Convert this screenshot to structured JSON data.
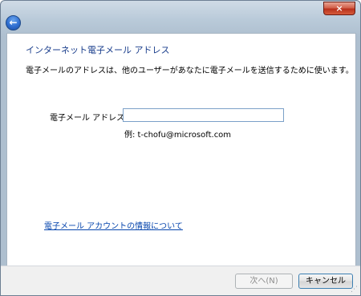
{
  "titlebar": {
    "close_label": "×",
    "close_icon": "close-icon"
  },
  "nav": {
    "back_label": "←",
    "back_icon": "back-arrow-icon"
  },
  "page": {
    "heading": "インターネット電子メール アドレス",
    "description": "電子メールのアドレスは、他のユーザーがあなたに電子メールを送信するために使います。",
    "email_label": "電子メール アドレス(E):",
    "email_value": "",
    "example": "例: t-chofu@microsoft.com",
    "info_link": "電子メール アカウントの情報について"
  },
  "footer": {
    "next_label": "次へ(N)",
    "cancel_label": "キャンセル"
  },
  "colors": {
    "heading": "#1a3e8c",
    "link": "#0645ad",
    "close": "#c4442a"
  }
}
